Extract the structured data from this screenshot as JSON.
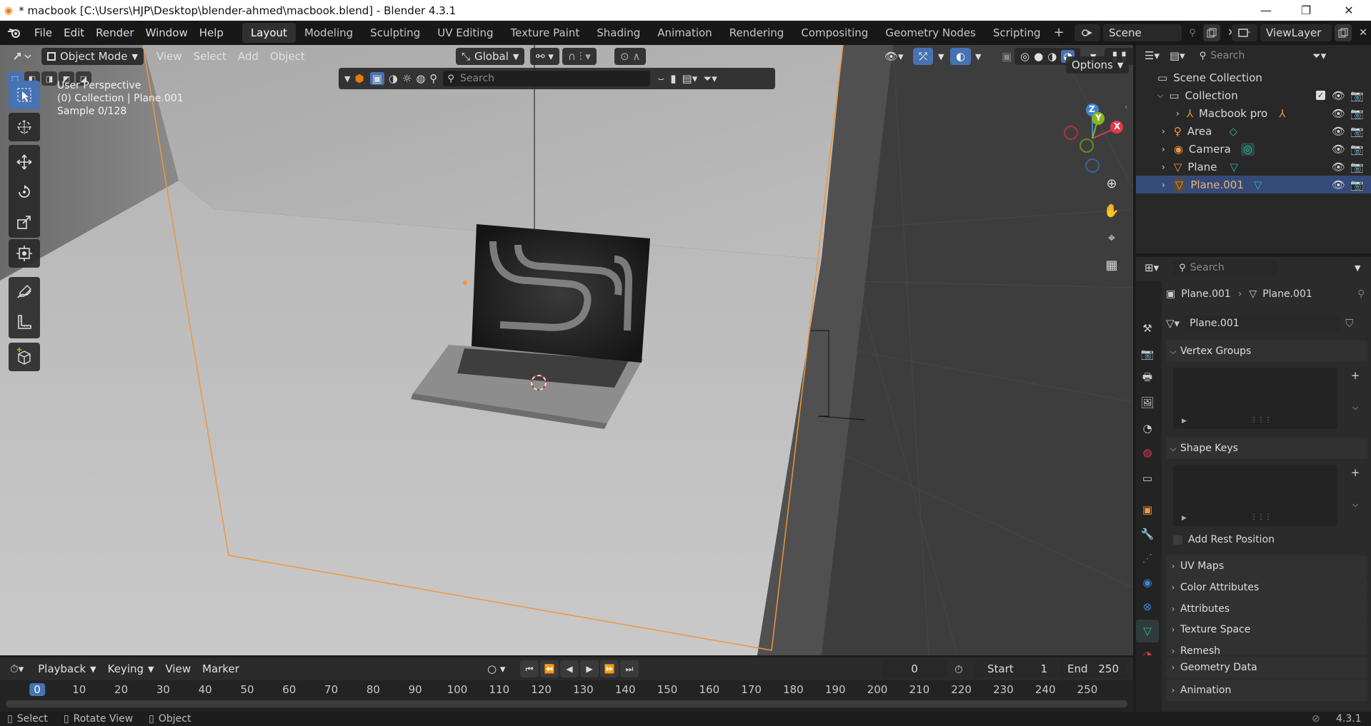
{
  "window": {
    "title": "* macbook [C:\\Users\\HJP\\Desktop\\blender-ahmed\\macbook.blend] - Blender 4.3.1",
    "minimize": "—",
    "maximize": "❐",
    "close": "✕"
  },
  "menu": {
    "items": [
      "File",
      "Edit",
      "Render",
      "Window",
      "Help"
    ]
  },
  "workspaces": {
    "tabs": [
      "Layout",
      "Modeling",
      "Sculpting",
      "UV Editing",
      "Texture Paint",
      "Shading",
      "Animation",
      "Rendering",
      "Compositing",
      "Geometry Nodes",
      "Scripting"
    ],
    "active": "Layout",
    "add": "+"
  },
  "scene": {
    "name": "Scene",
    "view_layer": "ViewLayer"
  },
  "viewport_header": {
    "mode": "Object Mode",
    "menus": [
      "View",
      "Select",
      "Add",
      "Object"
    ],
    "orientation": "Global",
    "options": "Options",
    "search_placeholder": "Search"
  },
  "viewport_info": {
    "line1": "User Perspective",
    "line2": "(0) Collection | Plane.001",
    "line3": "Sample 0/128"
  },
  "gizmo": {
    "x": "X",
    "y": "Y",
    "z": "Z"
  },
  "outliner": {
    "search_placeholder": "Search",
    "root": "Scene Collection",
    "collection": "Collection",
    "items": [
      {
        "label": "Macbook pro",
        "icon": "empty-icon"
      },
      {
        "label": "Area",
        "icon": "light-icon"
      },
      {
        "label": "Camera",
        "icon": "camera-icon"
      },
      {
        "label": "Plane",
        "icon": "mesh-icon"
      },
      {
        "label": "Plane.001",
        "icon": "mesh-icon",
        "selected": true
      }
    ]
  },
  "properties": {
    "search_placeholder": "Search",
    "breadcrumb_object": "Plane.001",
    "breadcrumb_data": "Plane.001",
    "data_name": "Plane.001",
    "panels": {
      "vertex_groups": "Vertex Groups",
      "shape_keys": "Shape Keys",
      "add_rest_position": "Add Rest Position",
      "uv_maps": "UV Maps",
      "color_attributes": "Color Attributes",
      "attributes": "Attributes",
      "texture_space": "Texture Space",
      "remesh": "Remesh",
      "geometry_data": "Geometry Data",
      "animation": "Animation"
    }
  },
  "timeline": {
    "menus": [
      "Playback",
      "Keying",
      "View",
      "Marker"
    ],
    "current_frame": "0",
    "start_label": "Start",
    "start": "1",
    "end_label": "End",
    "end": "250",
    "ruler": [
      "0",
      "10",
      "20",
      "30",
      "40",
      "50",
      "60",
      "70",
      "80",
      "90",
      "100",
      "110",
      "120",
      "130",
      "140",
      "150",
      "160",
      "170",
      "180",
      "190",
      "200",
      "210",
      "220",
      "230",
      "240",
      "250"
    ]
  },
  "statusbar": {
    "select": "Select",
    "rotate": "Rotate View",
    "object": "Object",
    "version": "4.3.1"
  },
  "colors": {
    "accent": "#4772b3",
    "selection_outline": "#f0963a",
    "axis_x": "#e3384f",
    "axis_y": "#8cb321",
    "axis_z": "#3f85d4"
  }
}
